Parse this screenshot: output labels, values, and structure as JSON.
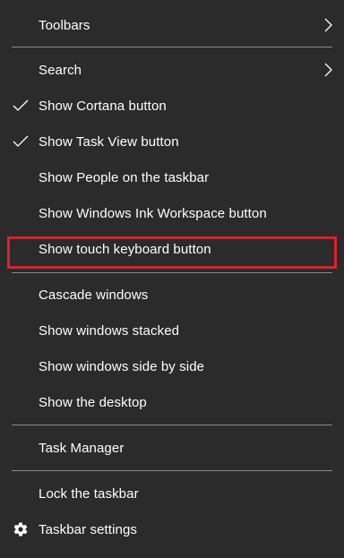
{
  "menu": {
    "items": [
      {
        "label": "Toolbars",
        "checked": false,
        "submenu": true,
        "icon": ""
      },
      {
        "label": "Search",
        "checked": false,
        "submenu": true,
        "icon": ""
      },
      {
        "label": "Show Cortana button",
        "checked": true,
        "submenu": false,
        "icon": ""
      },
      {
        "label": "Show Task View button",
        "checked": true,
        "submenu": false,
        "icon": ""
      },
      {
        "label": "Show People on the taskbar",
        "checked": false,
        "submenu": false,
        "icon": ""
      },
      {
        "label": "Show Windows Ink Workspace button",
        "checked": false,
        "submenu": false,
        "icon": ""
      },
      {
        "label": "Show touch keyboard button",
        "checked": false,
        "submenu": false,
        "icon": "",
        "highlighted": true
      },
      {
        "label": "Cascade windows",
        "checked": false,
        "submenu": false,
        "icon": ""
      },
      {
        "label": "Show windows stacked",
        "checked": false,
        "submenu": false,
        "icon": ""
      },
      {
        "label": "Show windows side by side",
        "checked": false,
        "submenu": false,
        "icon": ""
      },
      {
        "label": "Show the desktop",
        "checked": false,
        "submenu": false,
        "icon": ""
      },
      {
        "label": "Task Manager",
        "checked": false,
        "submenu": false,
        "icon": ""
      },
      {
        "label": "Lock the taskbar",
        "checked": false,
        "submenu": false,
        "icon": ""
      },
      {
        "label": "Taskbar settings",
        "checked": false,
        "submenu": false,
        "icon": "gear-icon"
      }
    ]
  },
  "colors": {
    "background": "#2b2b2b",
    "text": "#ffffff",
    "separator": "#8a8a8a",
    "highlight_border": "#e0202a"
  }
}
